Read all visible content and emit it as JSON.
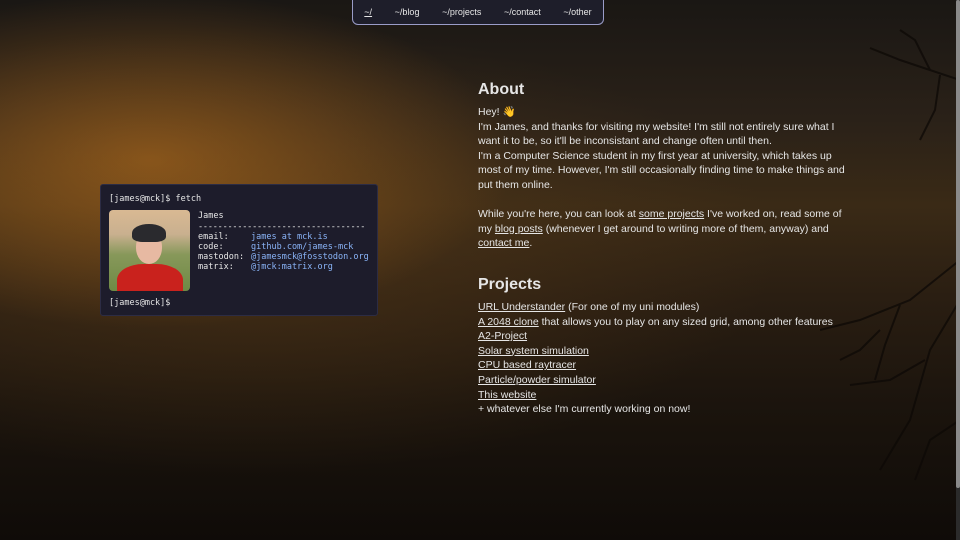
{
  "nav": {
    "items": [
      "~/",
      "~/blog",
      "~/projects",
      "~/contact",
      "~/other"
    ]
  },
  "terminal": {
    "prompt": "[james@mck]$",
    "command": "fetch",
    "name": "James",
    "separator": "----------------------------------",
    "fields": [
      {
        "key": "email:",
        "value": "james at mck.is"
      },
      {
        "key": "code:",
        "value": "github.com/james-mck"
      },
      {
        "key": "mastodon:",
        "value": "@jamesmck@fosstodon.org"
      },
      {
        "key": "matrix:",
        "value": "@jmck:matrix.org"
      }
    ]
  },
  "about": {
    "heading": "About",
    "greeting": "Hey! 👋",
    "intro": "I'm James, and thanks for visiting my website! I'm still not entirely sure what I want it to be, so it'll be inconsistant and change often until then.",
    "student": "I'm a Computer Science student in my first year at university, which takes up most of my time. However, I'm still occasionally finding time to make things and put them online.",
    "p2_a": "While you're here, you can look at ",
    "link_projects": "some projects",
    "p2_b": " I've worked on, read some of my ",
    "link_blog": "blog posts",
    "p2_c": " (whenever I get around to writing more of them, anyway) and ",
    "link_contact": "contact me",
    "p2_d": "."
  },
  "projects": {
    "heading": "Projects",
    "items": [
      {
        "link": "URL Understander",
        "suffix": " (For one of my uni modules)"
      },
      {
        "link": "A 2048 clone",
        "suffix": " that allows you to play on any sized grid, among other features"
      },
      {
        "link": "A2-Project",
        "suffix": ""
      },
      {
        "link": "Solar system simulation",
        "suffix": ""
      },
      {
        "link": "CPU based raytracer",
        "suffix": ""
      },
      {
        "link": "Particle/powder simulator",
        "suffix": ""
      },
      {
        "link": "This website",
        "suffix": ""
      }
    ],
    "footer": "+ whatever else I'm currently working on now!"
  },
  "colors": {
    "link": "#8ab4f8",
    "terminal_bg": "#1d1c2b",
    "nav_border": "#9a9cc8"
  }
}
